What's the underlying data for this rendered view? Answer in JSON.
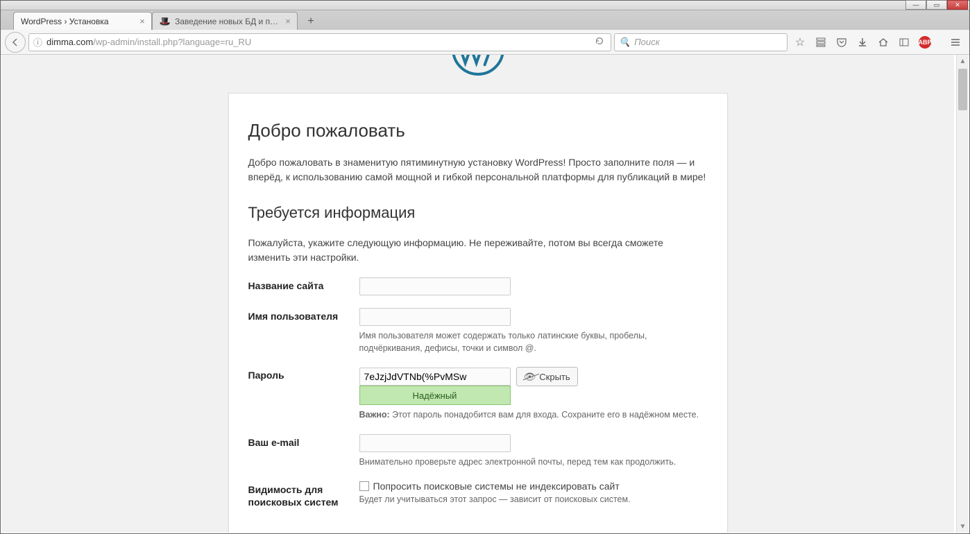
{
  "window": {
    "controls": {
      "min": "—",
      "max": "▭",
      "close": "✕"
    }
  },
  "tabs": [
    {
      "title": "WordPress › Установка",
      "active": true
    },
    {
      "title": "Заведение новых БД и по…",
      "active": false
    }
  ],
  "url": {
    "domain": "dimma.com",
    "path": "/wp-admin/install.php?language=ru_RU"
  },
  "search": {
    "placeholder": "Поиск"
  },
  "toolbar": {
    "abp": "ABP"
  },
  "content": {
    "welcome_heading": "Добро пожаловать",
    "welcome_text": "Добро пожаловать в знаменитую пятиминутную установку WordPress! Просто заполните поля — и вперёд, к использованию самой мощной и гибкой персональной платформы для публикаций в мире!",
    "info_heading": "Требуется информация",
    "info_text": "Пожалуйста, укажите следующую информацию. Не переживайте, потом вы всегда сможете изменить эти настройки.",
    "labels": {
      "site_title": "Название сайта",
      "username": "Имя пользователя",
      "password": "Пароль",
      "email": "Ваш e-mail",
      "visibility": "Видимость для поисковых систем"
    },
    "hints": {
      "username": "Имя пользователя может содержать только латинские буквы, пробелы, подчёркивания, дефисы, точки и символ @.",
      "password_important_label": "Важно:",
      "password_important": " Этот пароль понадобится вам для входа. Сохраните его в надёжном месте.",
      "email": "Внимательно проверьте адрес электронной почты, перед тем как продолжить.",
      "visibility": "Будет ли учитываться этот запрос — зависит от поисковых систем."
    },
    "password_value": "7eJzjJdVTNb(%PvMSw",
    "password_strength": "Надёжный",
    "hide_button": "Скрыть",
    "visibility_checkbox": "Попросить поисковые системы не индексировать сайт"
  }
}
